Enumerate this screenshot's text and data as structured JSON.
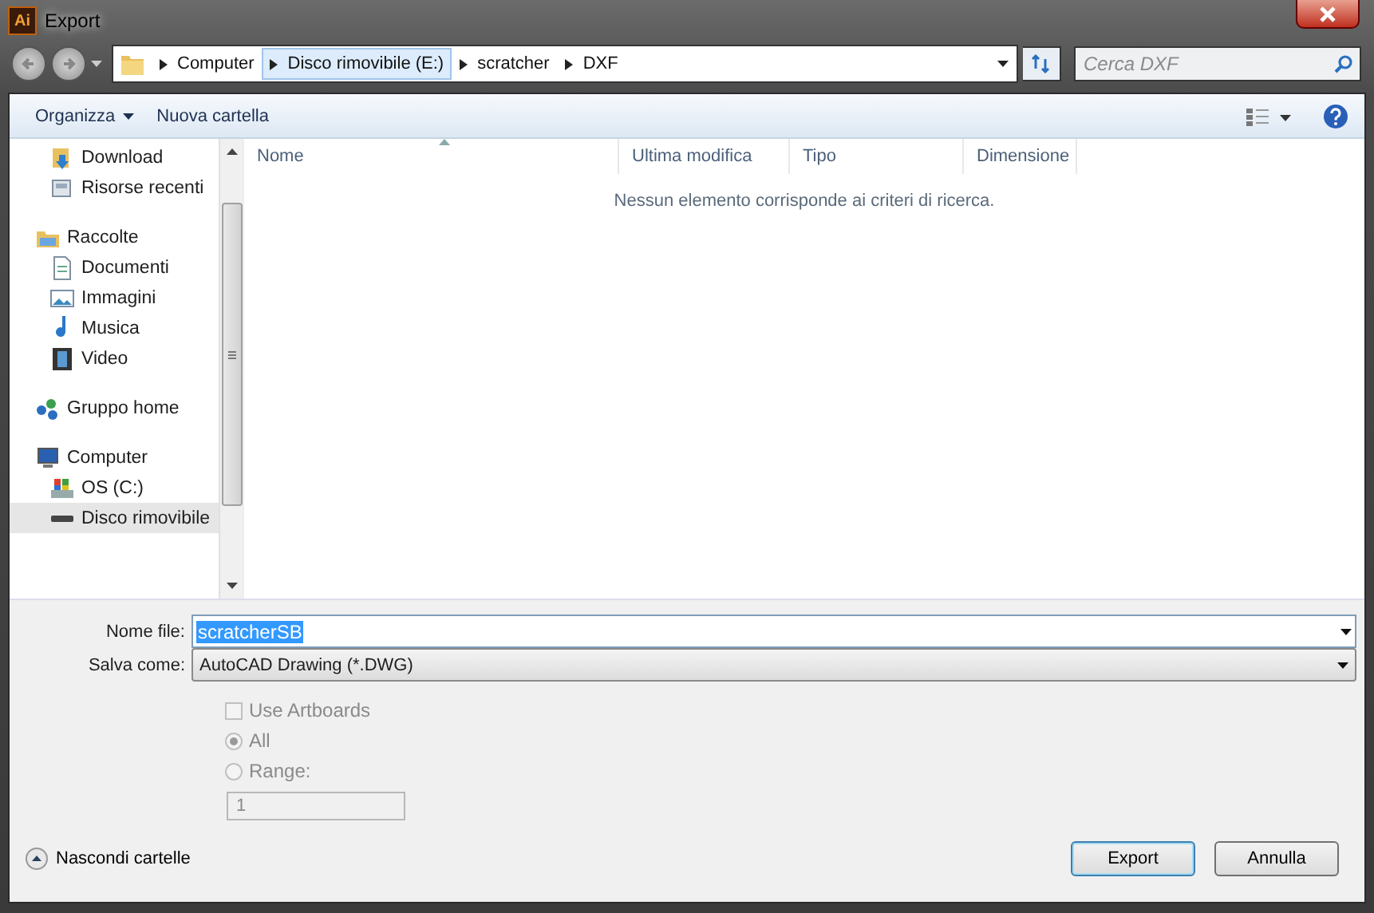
{
  "window": {
    "app_icon": "Ai",
    "title": "Export"
  },
  "address_bar": {
    "segments": [
      {
        "label": "Computer",
        "selected": false
      },
      {
        "label": "Disco rimovibile (E:)",
        "selected": true
      },
      {
        "label": "scratcher",
        "selected": false
      },
      {
        "label": "DXF",
        "selected": false
      }
    ]
  },
  "search": {
    "placeholder": "Cerca DXF"
  },
  "toolbar": {
    "items": [
      {
        "label": "Organizza",
        "has_menu": true
      },
      {
        "label": "Nuova cartella",
        "has_menu": false
      }
    ]
  },
  "sidebar": {
    "items": [
      {
        "children": [
          {
            "label": "Download",
            "kind": "download",
            "selected": false
          },
          {
            "label": "Risorse recenti",
            "kind": "recent",
            "selected": false
          }
        ]
      },
      {
        "label": "Raccolte",
        "kind": "library",
        "selected": false,
        "children": [
          {
            "label": "Documenti",
            "kind": "document",
            "selected": false
          },
          {
            "label": "Immagini",
            "kind": "image",
            "selected": false
          },
          {
            "label": "Musica",
            "kind": "music",
            "selected": false
          },
          {
            "label": "Video",
            "kind": "video",
            "selected": false
          }
        ]
      },
      {
        "label": "Gruppo home",
        "kind": "homegroup",
        "selected": false
      },
      {
        "label": "Computer",
        "kind": "computer",
        "selected": false,
        "children": [
          {
            "label": "OS (C:)",
            "kind": "os_drive",
            "selected": false
          },
          {
            "label": "Disco rimovibile",
            "kind": "removable",
            "selected": true
          }
        ]
      }
    ]
  },
  "table": {
    "columns": [
      "Nome",
      "Ultima modifica",
      "Tipo",
      "Dimensione"
    ],
    "empty_message": "Nessun elemento corrisponde ai criteri di ricerca."
  },
  "file_name": {
    "label": "Nome file:",
    "value": "scratcherSB"
  },
  "save_as": {
    "label": "Salva come:",
    "value": "AutoCAD Drawing (*.DWG)"
  },
  "options": {
    "use_artboards": {
      "label": "Use Artboards",
      "checked": false,
      "disabled": true
    },
    "radios": [
      {
        "label": "All",
        "selected": true,
        "disabled": true
      },
      {
        "label": "Range:",
        "selected": false,
        "disabled": true
      }
    ],
    "range": {
      "value": "1",
      "disabled": true
    }
  },
  "hide_folders": {
    "label": "Nascondi cartelle"
  },
  "buttons": [
    {
      "label": "Export",
      "default": true
    },
    {
      "label": "Annulla",
      "default": false
    }
  ]
}
